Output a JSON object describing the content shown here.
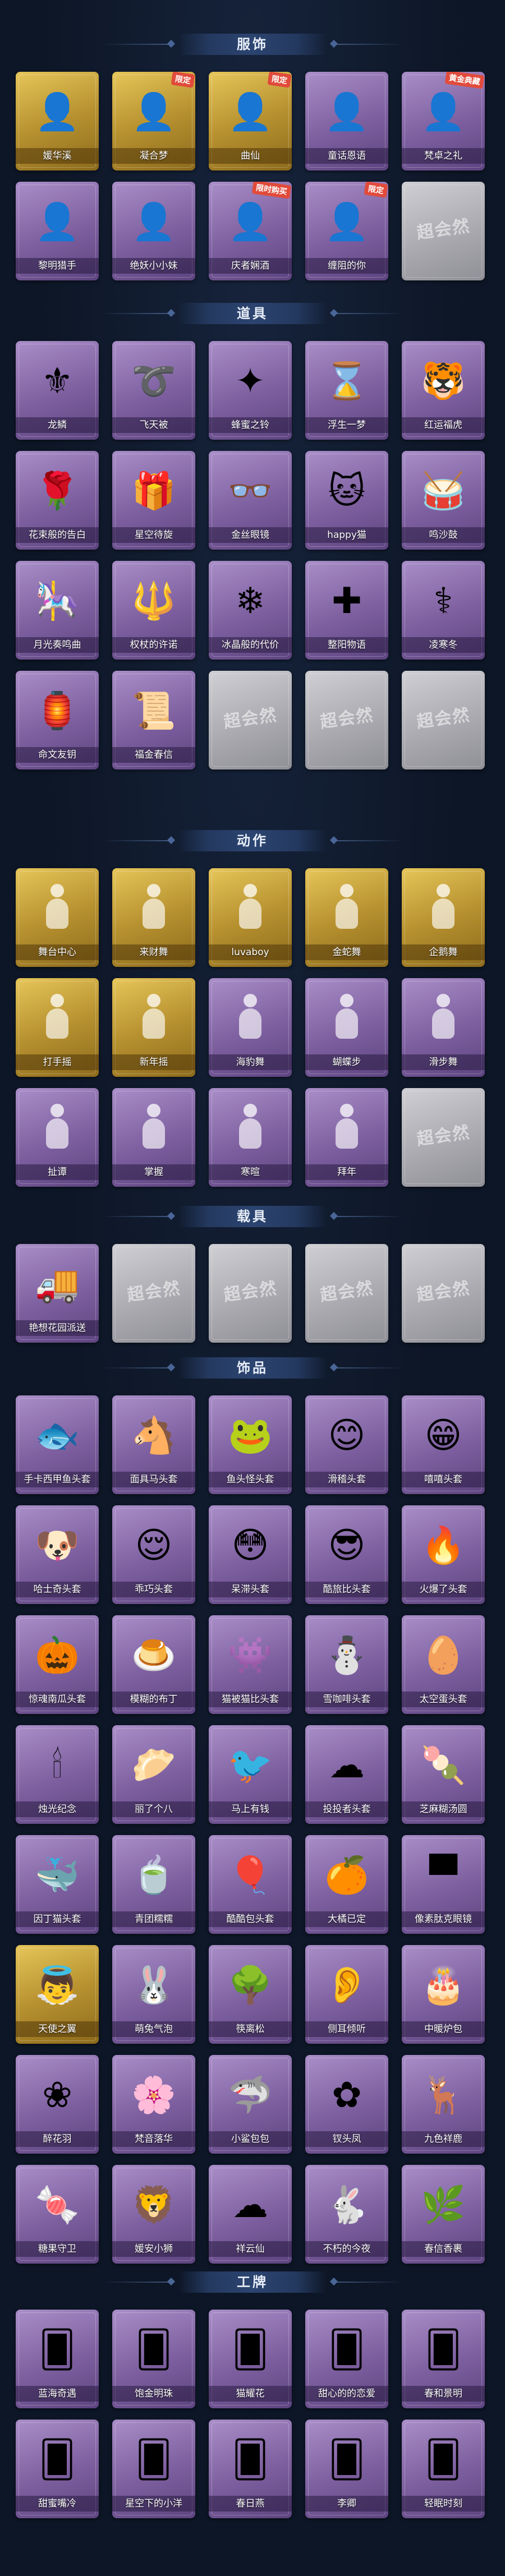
{
  "sections": [
    {
      "title": "服饰",
      "items": [
        {
          "label": "媛华溪",
          "icon": "character-portrait",
          "style": "gold",
          "badge": ""
        },
        {
          "label": "凝合梦",
          "icon": "character-portrait",
          "style": "gold",
          "badge": "限定"
        },
        {
          "label": "曲仙",
          "icon": "character-portrait",
          "style": "gold",
          "badge": "限定"
        },
        {
          "label": "童话恩语",
          "icon": "character-portrait",
          "style": "purple",
          "badge": ""
        },
        {
          "label": "梵卓之礼",
          "icon": "character-portrait",
          "style": "purple",
          "badge": "黄金典藏"
        },
        {
          "label": "黎明猎手",
          "icon": "character-portrait",
          "style": "purple",
          "badge": ""
        },
        {
          "label": "绝妖小小妹",
          "icon": "character-portrait",
          "style": "purple",
          "badge": ""
        },
        {
          "label": "庆者娴酒",
          "icon": "character-portrait",
          "style": "purple",
          "badge": "限时购买"
        },
        {
          "label": "缠阻的你",
          "icon": "character-portrait",
          "style": "purple",
          "badge": "限定"
        },
        {
          "label": "",
          "icon": "placeholder",
          "style": "grey",
          "badge": "",
          "watermark": "超会然"
        }
      ]
    },
    {
      "title": "道具",
      "items": [
        {
          "label": "龙鳞",
          "icon": "golden-scepter-icon",
          "style": "purple",
          "badge": ""
        },
        {
          "label": "飞天被",
          "icon": "ribbon-icon",
          "style": "purple",
          "badge": ""
        },
        {
          "label": "蜂蜜之铃",
          "icon": "wand-icon",
          "style": "purple",
          "badge": ""
        },
        {
          "label": "浮生一梦",
          "icon": "hourglass-icon",
          "style": "purple",
          "badge": ""
        },
        {
          "label": "红运福虎",
          "icon": "tiger-icon",
          "style": "purple",
          "badge": ""
        },
        {
          "label": "花束般的告白",
          "icon": "rose-icon",
          "style": "purple",
          "badge": ""
        },
        {
          "label": "星空待旋",
          "icon": "gift-box-icon",
          "style": "purple",
          "badge": ""
        },
        {
          "label": "金丝眼镜",
          "icon": "glasses-icon",
          "style": "purple",
          "badge": ""
        },
        {
          "label": "happy猫",
          "icon": "cat-icon",
          "style": "purple",
          "badge": ""
        },
        {
          "label": "鸣沙鼓",
          "icon": "drum-icon",
          "style": "purple",
          "badge": ""
        },
        {
          "label": "月光奏鸣曲",
          "icon": "music-box-icon",
          "style": "purple",
          "badge": ""
        },
        {
          "label": "权杖的许诺",
          "icon": "scepter-icon",
          "style": "purple",
          "badge": ""
        },
        {
          "label": "冰晶般的代价",
          "icon": "ice-flower-icon",
          "style": "purple",
          "badge": ""
        },
        {
          "label": "整阳物语",
          "icon": "medical-case-icon",
          "style": "purple",
          "badge": ""
        },
        {
          "label": "凌寒冬",
          "icon": "staff-icon",
          "style": "purple",
          "badge": ""
        },
        {
          "label": "命文友钥",
          "icon": "lantern-icon",
          "style": "purple",
          "badge": ""
        },
        {
          "label": "福金春信",
          "icon": "scroll-icon",
          "style": "purple",
          "badge": ""
        },
        {
          "label": "",
          "icon": "placeholder",
          "style": "grey",
          "badge": "",
          "watermark": "超会然"
        },
        {
          "label": "",
          "icon": "placeholder",
          "style": "grey",
          "badge": "",
          "watermark": "超会然"
        },
        {
          "label": "",
          "icon": "placeholder",
          "style": "grey",
          "badge": "",
          "watermark": "超会然"
        }
      ]
    },
    {
      "title": "动作",
      "items": [
        {
          "label": "舞台中心",
          "icon": "pose-figure",
          "style": "gold",
          "badge": ""
        },
        {
          "label": "来财舞",
          "icon": "pose-figure",
          "style": "gold",
          "badge": ""
        },
        {
          "label": "luvaboy",
          "icon": "pose-figure",
          "style": "gold",
          "badge": ""
        },
        {
          "label": "金蛇舞",
          "icon": "pose-figure",
          "style": "gold",
          "badge": ""
        },
        {
          "label": "企鹅舞",
          "icon": "pose-figure",
          "style": "gold",
          "badge": ""
        },
        {
          "label": "打手摇",
          "icon": "pose-figure",
          "style": "gold",
          "badge": ""
        },
        {
          "label": "新年摇",
          "icon": "pose-figure",
          "style": "gold",
          "badge": ""
        },
        {
          "label": "海豹舞",
          "icon": "pose-figure",
          "style": "purple",
          "badge": ""
        },
        {
          "label": "蝴蝶步",
          "icon": "pose-figure",
          "style": "purple",
          "badge": ""
        },
        {
          "label": "滑步舞",
          "icon": "pose-figure",
          "style": "purple",
          "badge": ""
        },
        {
          "label": "扯谭",
          "icon": "pose-figure",
          "style": "purple",
          "badge": ""
        },
        {
          "label": "掌握",
          "icon": "pose-figure",
          "style": "purple",
          "badge": ""
        },
        {
          "label": "寒暄",
          "icon": "pose-figure",
          "style": "purple",
          "badge": ""
        },
        {
          "label": "拜年",
          "icon": "pose-figure",
          "style": "purple",
          "badge": ""
        },
        {
          "label": "",
          "icon": "placeholder",
          "style": "grey",
          "badge": "",
          "watermark": "超会然"
        }
      ]
    },
    {
      "title": "载具",
      "items": [
        {
          "label": "艳想花园派送",
          "icon": "truck-icon",
          "style": "purple",
          "badge": ""
        },
        {
          "label": "",
          "icon": "placeholder",
          "style": "grey",
          "badge": "",
          "watermark": "超会然"
        },
        {
          "label": "",
          "icon": "placeholder",
          "style": "grey",
          "badge": "",
          "watermark": "超会然"
        },
        {
          "label": "",
          "icon": "placeholder",
          "style": "grey",
          "badge": "",
          "watermark": "超会然"
        },
        {
          "label": "",
          "icon": "placeholder",
          "style": "grey",
          "badge": "",
          "watermark": "超会然"
        }
      ]
    },
    {
      "title": "饰品",
      "items": [
        {
          "label": "手卡西甲鱼头套",
          "icon": "fish-mask",
          "style": "purple",
          "badge": ""
        },
        {
          "label": "面具马头套",
          "icon": "horse-mask",
          "style": "purple",
          "badge": ""
        },
        {
          "label": "鱼头怪头套",
          "icon": "fish-head",
          "style": "purple",
          "badge": ""
        },
        {
          "label": "滑稽头套",
          "icon": "smile-face",
          "style": "purple",
          "badge": ""
        },
        {
          "label": "嘻嘻头套",
          "icon": "grin-face",
          "style": "purple",
          "badge": ""
        },
        {
          "label": "哈士奇头套",
          "icon": "dog-mask",
          "style": "purple",
          "badge": ""
        },
        {
          "label": "乖巧头套",
          "icon": "sleepy-face",
          "style": "purple",
          "badge": ""
        },
        {
          "label": "呆滞头套",
          "icon": "stare-face",
          "style": "purple",
          "badge": ""
        },
        {
          "label": "酷旅比头套",
          "icon": "cool-pikachu",
          "style": "purple",
          "badge": ""
        },
        {
          "label": "火爆了头套",
          "icon": "fire-face",
          "style": "purple",
          "badge": ""
        },
        {
          "label": "惊魂南瓜头套",
          "icon": "pumpkin",
          "style": "purple",
          "badge": ""
        },
        {
          "label": "模糊的布丁",
          "icon": "pudding",
          "style": "purple",
          "badge": ""
        },
        {
          "label": "猫被猫比头套",
          "icon": "pink-monster",
          "style": "purple",
          "badge": ""
        },
        {
          "label": "雪咖啡头套",
          "icon": "snowman",
          "style": "purple",
          "badge": ""
        },
        {
          "label": "太空蛋头套",
          "icon": "egg",
          "style": "purple",
          "badge": ""
        },
        {
          "label": "烛光纪念",
          "icon": "candle",
          "style": "purple",
          "badge": ""
        },
        {
          "label": "丽了个八",
          "icon": "steamed-bun",
          "style": "purple",
          "badge": ""
        },
        {
          "label": "马上有钱",
          "icon": "red-bird",
          "style": "purple",
          "badge": ""
        },
        {
          "label": "投投者头套",
          "icon": "cloud-dog",
          "style": "purple",
          "badge": ""
        },
        {
          "label": "芝麻糊汤圆",
          "icon": "rice-ball",
          "style": "purple",
          "badge": ""
        },
        {
          "label": "因丁猫头套",
          "icon": "blue-cat",
          "style": "purple",
          "badge": ""
        },
        {
          "label": "青团糯糯",
          "icon": "green-dumpling",
          "style": "purple",
          "badge": ""
        },
        {
          "label": "酷酷包头套",
          "icon": "balloon",
          "style": "purple",
          "badge": ""
        },
        {
          "label": "大橘已定",
          "icon": "orange-face",
          "style": "purple",
          "badge": ""
        },
        {
          "label": "像素肽克眼镜",
          "icon": "pixel-glasses",
          "style": "purple",
          "badge": ""
        },
        {
          "label": "天使之翼",
          "icon": "angel-wings",
          "style": "gold",
          "badge": ""
        },
        {
          "label": "萌兔气泡",
          "icon": "bunny-bubble",
          "style": "purple",
          "badge": ""
        },
        {
          "label": "筷离松",
          "icon": "bonsai",
          "style": "purple",
          "badge": ""
        },
        {
          "label": "侧耳倾听",
          "icon": "pink-ear",
          "style": "purple",
          "badge": ""
        },
        {
          "label": "中暖炉包",
          "icon": "cake",
          "style": "purple",
          "badge": ""
        },
        {
          "label": "醉花羽",
          "icon": "feather-wreath",
          "style": "purple",
          "badge": ""
        },
        {
          "label": "梵音落华",
          "icon": "flower-fairy",
          "style": "purple",
          "badge": ""
        },
        {
          "label": "小鲨包包",
          "icon": "shark-bag",
          "style": "purple",
          "badge": ""
        },
        {
          "label": "钗头凤",
          "icon": "phoenix-hairpin",
          "style": "purple",
          "badge": ""
        },
        {
          "label": "九色祥鹿",
          "icon": "deer",
          "style": "purple",
          "badge": ""
        },
        {
          "label": "糖果守卫",
          "icon": "candy-guard",
          "style": "purple",
          "badge": ""
        },
        {
          "label": "媛安小狮",
          "icon": "lion-doll",
          "style": "purple",
          "badge": ""
        },
        {
          "label": "祥云仙",
          "icon": "cloud-charm",
          "style": "purple",
          "badge": ""
        },
        {
          "label": "不朽的今夜",
          "icon": "pink-bunny",
          "style": "purple",
          "badge": ""
        },
        {
          "label": "春信香裹",
          "icon": "green-sachet",
          "style": "purple",
          "badge": ""
        }
      ]
    },
    {
      "title": "工牌",
      "items": [
        {
          "label": "蓝海奇遇",
          "icon": "card-badge",
          "style": "purple",
          "badge": ""
        },
        {
          "label": "饱金明珠",
          "icon": "card-badge",
          "style": "purple",
          "badge": ""
        },
        {
          "label": "猫耀花",
          "icon": "card-badge",
          "style": "purple",
          "badge": ""
        },
        {
          "label": "甜心的的恋爱",
          "icon": "card-badge",
          "style": "purple",
          "badge": ""
        },
        {
          "label": "春和景明",
          "icon": "card-badge",
          "style": "purple",
          "badge": ""
        },
        {
          "label": "甜蜜嘴冷",
          "icon": "card-badge",
          "style": "purple",
          "badge": ""
        },
        {
          "label": "星空下的小洋",
          "icon": "card-badge",
          "style": "purple",
          "badge": ""
        },
        {
          "label": "春日燕",
          "icon": "card-badge",
          "style": "purple",
          "badge": ""
        },
        {
          "label": "李卿",
          "icon": "card-badge",
          "style": "purple",
          "badge": ""
        },
        {
          "label": "轻眠时刻",
          "icon": "card-badge",
          "style": "purple",
          "badge": ""
        }
      ]
    }
  ]
}
